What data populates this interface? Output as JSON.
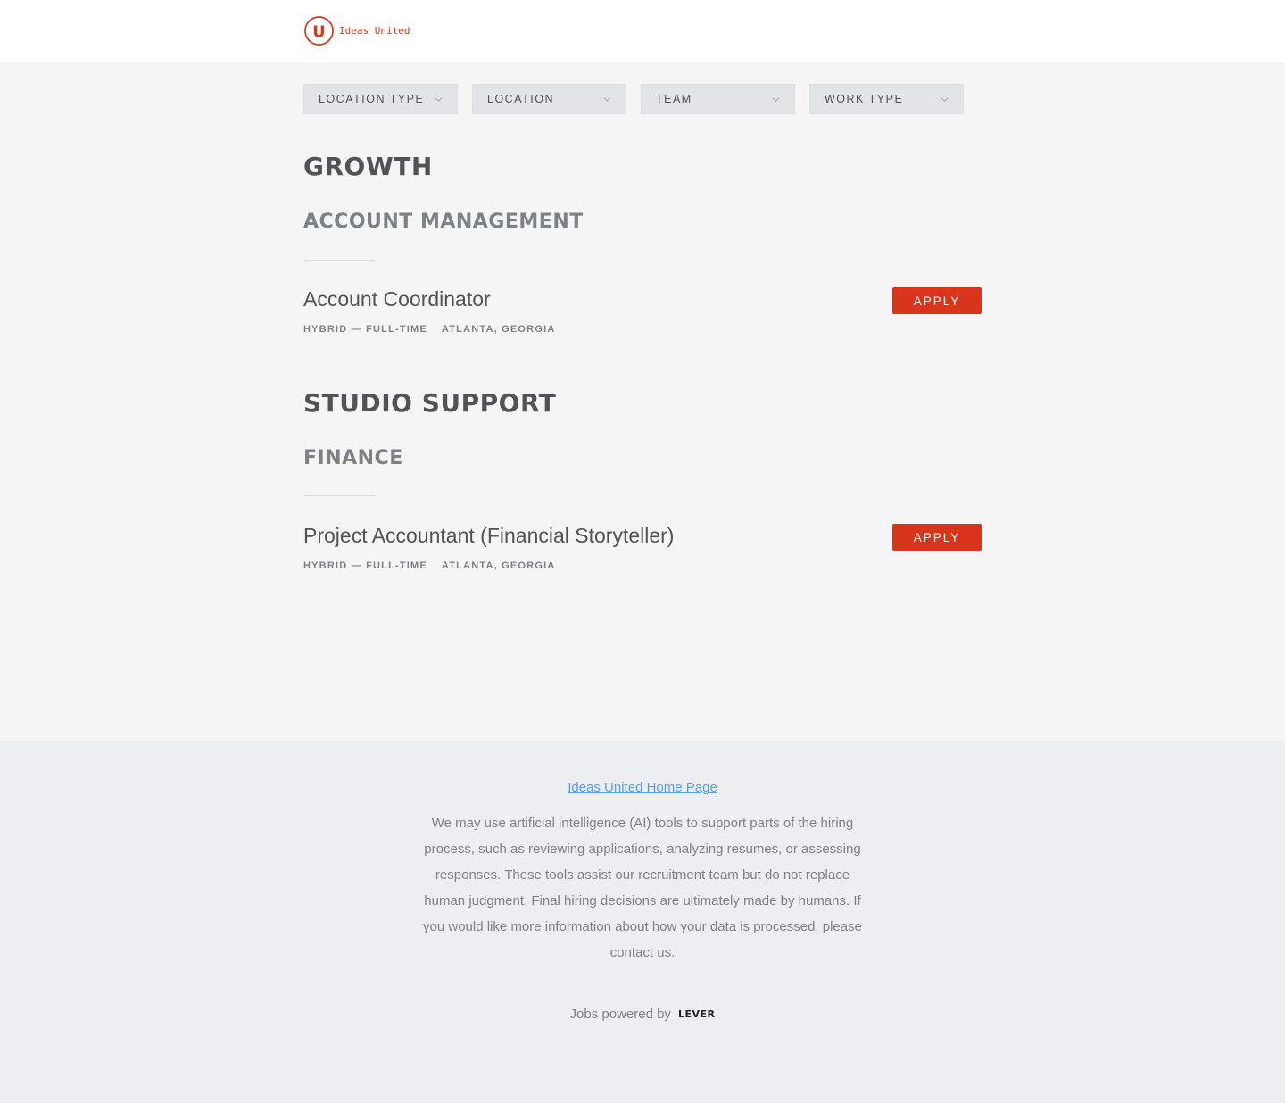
{
  "header": {
    "logo_text": "Ideas United",
    "logo_letter": "U",
    "brand_color": "#d9371c"
  },
  "filters": [
    {
      "label": "LOCATION TYPE"
    },
    {
      "label": "LOCATION"
    },
    {
      "label": "TEAM"
    },
    {
      "label": "WORK TYPE"
    }
  ],
  "groups": [
    {
      "department": "GROWTH",
      "team": "ACCOUNT MANAGEMENT",
      "postings": [
        {
          "title": "Account Coordinator",
          "commitment": "HYBRID — FULL-TIME",
          "location": "ATLANTA, GEORGIA",
          "apply_label": "APPLY"
        }
      ]
    },
    {
      "department": "STUDIO SUPPORT",
      "team": "FINANCE",
      "postings": [
        {
          "title": "Project Accountant (Financial Storyteller)",
          "commitment": "HYBRID — FULL-TIME",
          "location": "ATLANTA, GEORGIA",
          "apply_label": "APPLY"
        }
      ]
    }
  ],
  "footer": {
    "home_link": "Ideas United Home Page",
    "disclaimer": "We may use artificial intelligence (AI) tools to support parts of the hiring process, such as reviewing applications, analyzing resumes, or assessing responses. These tools assist our recruitment team but do not replace human judgment. Final hiring decisions are ultimately made by humans. If you would like more information about how your data is processed, please contact us.",
    "powered_by": "Jobs powered by",
    "lever_brand": "LEVER",
    "link_color": "#579eee",
    "apply_color": "#d9341c"
  }
}
